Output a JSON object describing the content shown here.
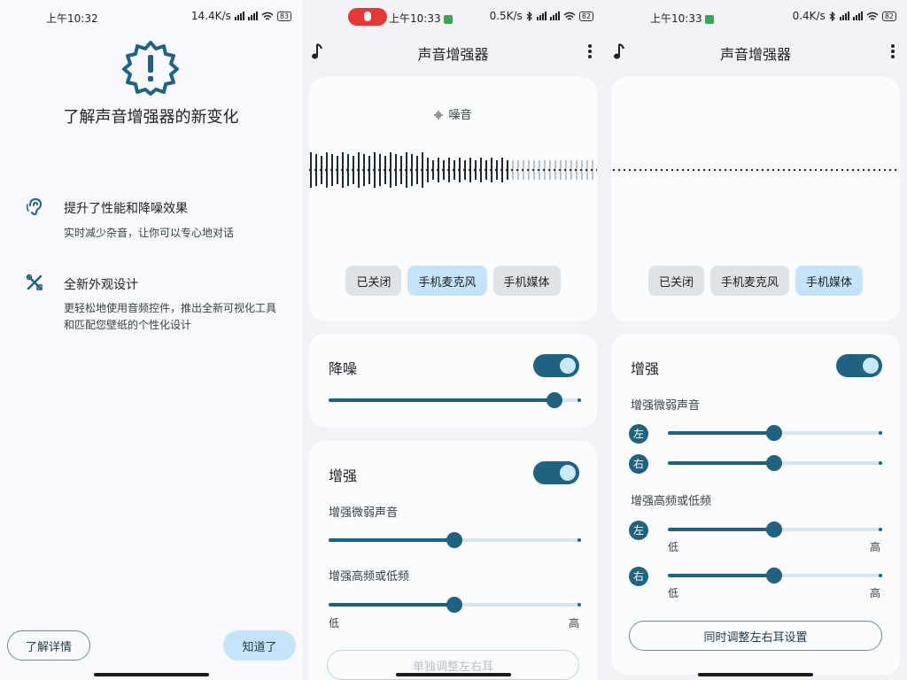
{
  "pane1": {
    "status": {
      "time": "上午10:32",
      "speed": "14.4K/s",
      "battery": "83"
    },
    "title": "了解声音增强器的新变化",
    "features": [
      {
        "title": "提升了性能和降噪效果",
        "desc": "实时减少杂音，让你可以专心地对话",
        "icon": "ear-icon"
      },
      {
        "title": "全新外观设计",
        "desc": "更轻松地使用音频控件，推出全新可视化工具和匹配您壁纸的个性化设计",
        "icon": "design-tools-icon"
      }
    ],
    "learn_more": "了解详情",
    "got_it": "知道了"
  },
  "pane2": {
    "status": {
      "time": "上午10:33",
      "speed": "0.5K/s",
      "battery": "82"
    },
    "app_title": "声音增强器",
    "viz_label": "噪音",
    "source_chips": [
      "已关闭",
      "手机麦克风",
      "手机媒体"
    ],
    "active_chip": 1,
    "noise_title": "降噪",
    "noise_value": 0.9,
    "enhance_title": "增强",
    "weak_label": "增强微弱声音",
    "weak_value": 0.5,
    "freq_label": "增强高频或低频",
    "freq_value": 0.5,
    "low": "低",
    "high": "高",
    "separate_button": "单独调整左右耳"
  },
  "pane3": {
    "status": {
      "time": "上午10:33",
      "speed": "0.4K/s",
      "battery": "82"
    },
    "app_title": "声音增强器",
    "source_chips": [
      "已关闭",
      "手机麦克风",
      "手机媒体"
    ],
    "active_chip": 2,
    "enhance_title": "增强",
    "weak_label": "增强微弱声音",
    "left": "左",
    "right": "右",
    "weak_left_value": 0.5,
    "weak_right_value": 0.5,
    "freq_label": "增强高频或低频",
    "freq_left_value": 0.5,
    "freq_right_value": 0.5,
    "low": "低",
    "high": "高",
    "both_button": "同时调整左右耳设置"
  },
  "colors": {
    "accent": "#1f6380",
    "accent_light": "#c4e4f7",
    "track": "#d3e6f2"
  }
}
